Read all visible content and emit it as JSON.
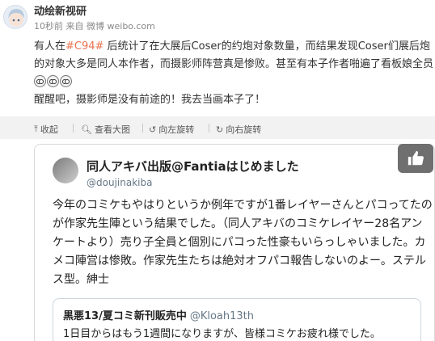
{
  "post": {
    "username": "动绘新视研",
    "time": "10秒前",
    "via_prefix": "来自",
    "via_source": "微博 weibo.com",
    "text_a": "有人在",
    "tag": "#C94#",
    "text_b": " 后统计了在大展后Coser的约炮对象数量，而结果发现Coser们展后炮的对象大多是同人本作者，而摄影师阵营真是惨败。甚至有本子作者啪遍了看板娘全员",
    "line2": "醒醒吧，摄影师是没有前途的！我去当画本子了！",
    "emoticon_count": 3
  },
  "toolbar": {
    "collapse": "收起",
    "view_large": "查看大图",
    "rotate_left": "向左旋转",
    "rotate_right": "向右旋转"
  },
  "tweet": {
    "name": "同人アキバ出版@Fantiaはじめました",
    "handle": "@doujinakiba",
    "body": "今年のコミケもやはりというか例年ですが1番レイヤーさんとパコってたのが作家先生陣という結果でした。（同人アキバのコミケレイヤー28名アンケートより）売り子全員と個別にパコった性豪もいらっしゃいました。カメコ陣営は惨敗。作家先生たちは絶対オフパコ報告しないのよー。ステルス型。紳士",
    "quote_name": "黒悪13/夏コミ新刊販売中",
    "quote_handle": "@Kloah13th",
    "quote_text": "1日目からはもう1週間になりますが、皆様コミケお疲れ様でした。"
  },
  "colors": {
    "tag": "#eb7350",
    "toolbar_bg": "#f2f2f2",
    "handle": "#657786"
  },
  "icons": [
    "avatar-girl",
    "collapse-arrow-icon",
    "magnify-icon",
    "rotate-left-icon",
    "rotate-right-icon",
    "thumbs-up-icon",
    "crying-emoticon"
  ]
}
